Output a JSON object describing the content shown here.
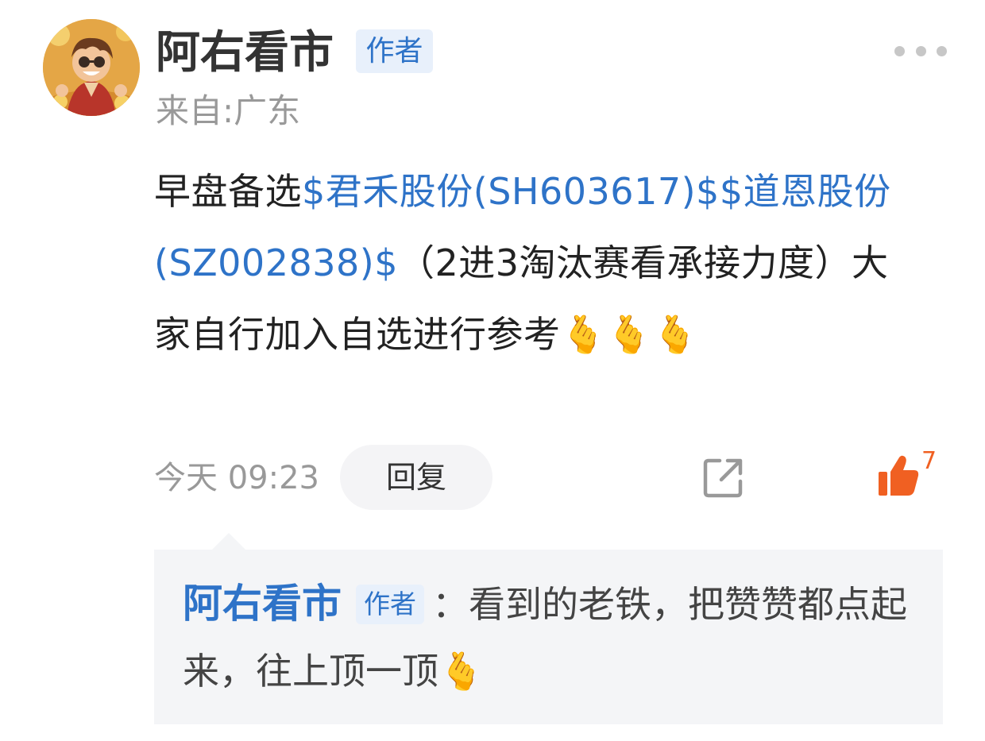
{
  "post": {
    "author_name": "阿右看市",
    "author_badge": "作者",
    "location": "来自:广东",
    "content_prefix": "早盘备选",
    "stock_1": "$君禾股份(SH603617)$",
    "stock_2": "$道恩股份(SZ002838)$",
    "content_suffix": "（2进3淘汰赛看承接力度）大家自行加入自选进行参考",
    "emoji": "🫰🫰🫰",
    "time": "今天 09:23",
    "reply_label": "回复",
    "like_count": "7"
  },
  "reply": {
    "author_name": "阿右看市",
    "author_badge": "作者",
    "separator": "：",
    "text": "看到的老铁，把赞赞都点起来，往上顶一顶",
    "emoji": "🫰"
  },
  "colors": {
    "link_blue": "#2e73c8",
    "like_orange": "#f06022",
    "muted_gray": "#999999",
    "reply_bg": "#f4f5f7"
  },
  "icons": {
    "more": "more-dots-icon",
    "share": "share-external-icon",
    "like": "thumbs-up-icon",
    "avatar": "cartoon-boy-avatar"
  }
}
